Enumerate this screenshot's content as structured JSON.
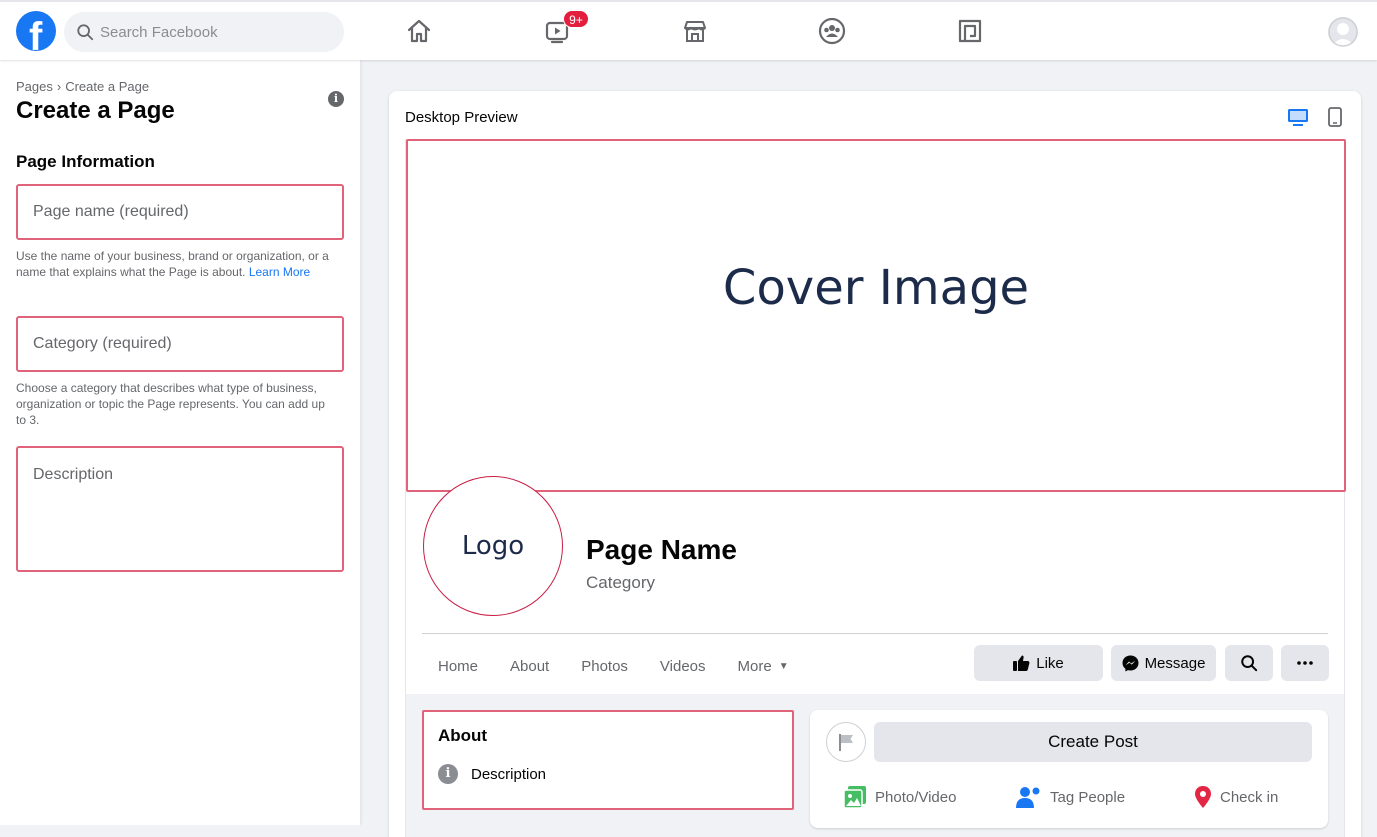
{
  "topbar": {
    "logo_letter": "f",
    "search_placeholder": "Search Facebook",
    "watch_badge": "9+"
  },
  "left": {
    "breadcrumb": [
      "Pages",
      "Create a Page"
    ],
    "breadcrumb_sep": "›",
    "title": "Create a Page",
    "section": "Page Information",
    "page_name_placeholder": "Page name (required)",
    "page_name_help": "Use the name of your business, brand or organization, or a name that explains what the Page is about.",
    "learn_more": "Learn More",
    "category_placeholder": "Category (required)",
    "category_help": "Choose a category that describes what type of business, organization or topic the Page represents. You can add up to 3.",
    "description_placeholder": "Description"
  },
  "preview": {
    "title": "Desktop Preview",
    "cover": "Cover Image",
    "logo": "Logo",
    "page_name": "Page Name",
    "category": "Category",
    "tabs": [
      "Home",
      "About",
      "Photos",
      "Videos",
      "More"
    ],
    "actions": {
      "like": "Like",
      "message": "Message"
    },
    "about": {
      "title": "About",
      "description": "Description"
    },
    "create_post": {
      "button": "Create Post",
      "photo": "Photo/Video",
      "tag": "Tag People",
      "checkin": "Check in"
    }
  },
  "colors": {
    "brand": "#1877f2",
    "highlight_border": "#e0637a",
    "badge": "#e41e3f"
  }
}
